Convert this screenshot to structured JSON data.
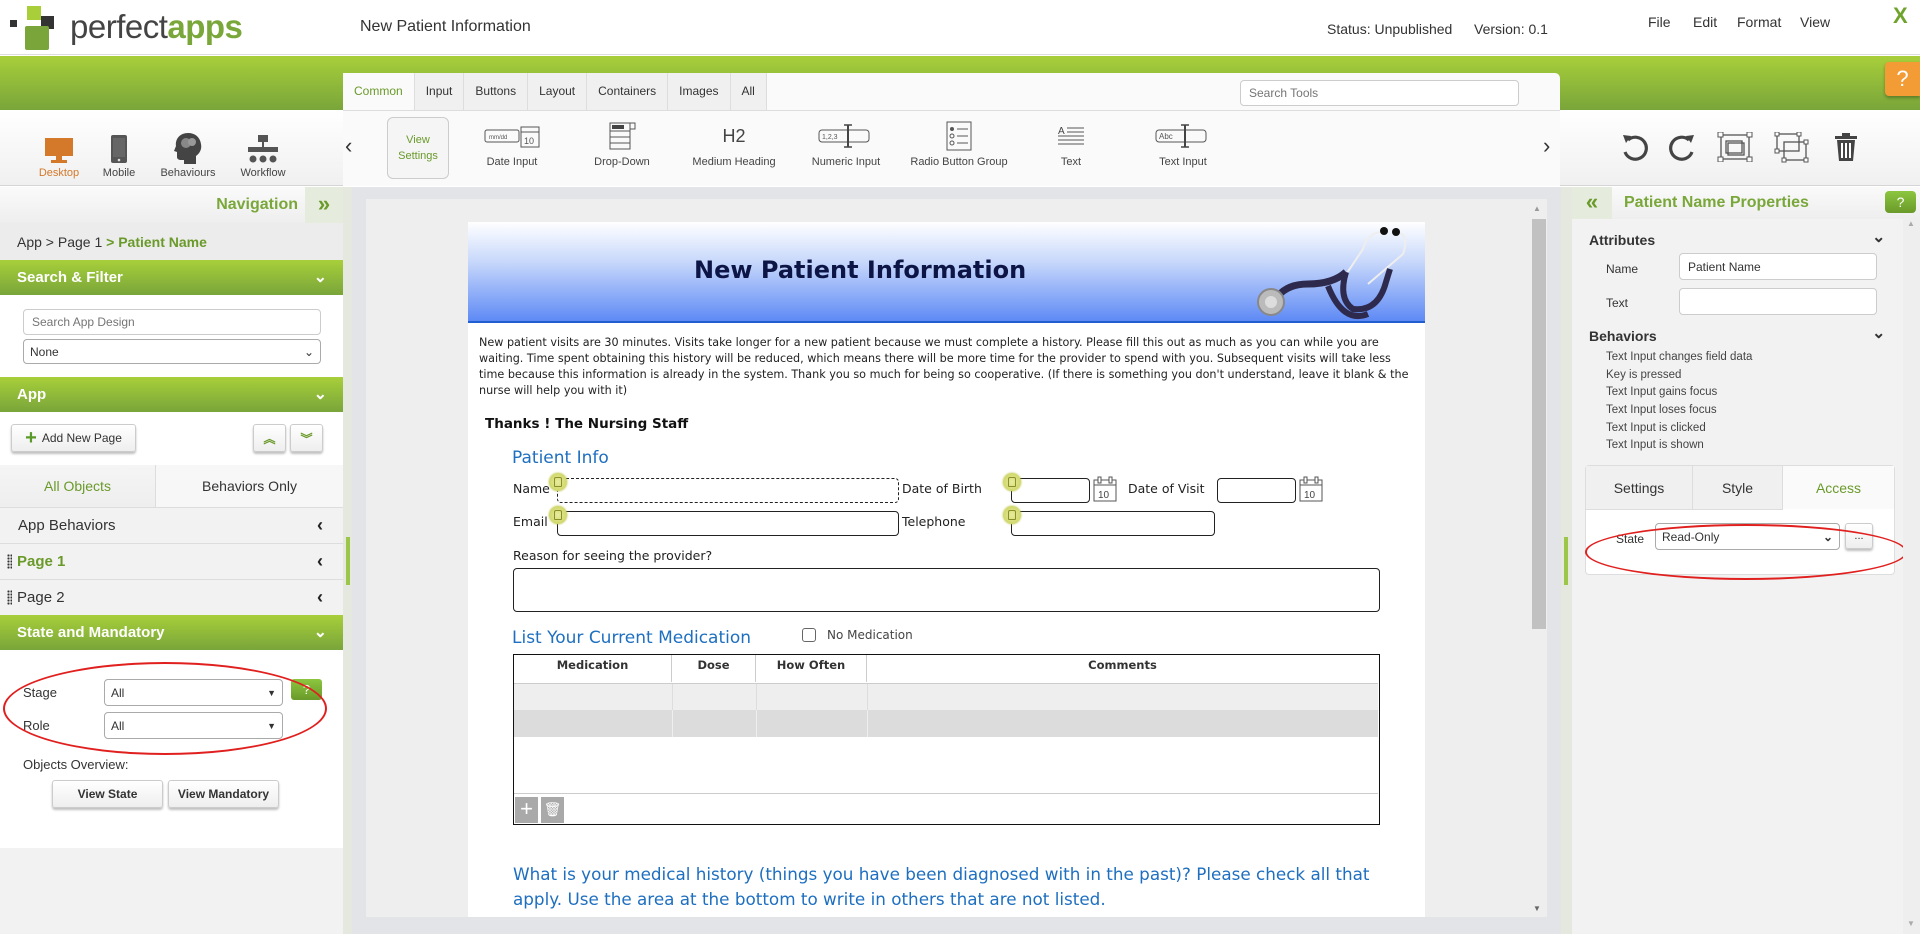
{
  "header": {
    "logo_text_plain": "perfect",
    "logo_text_bold": "apps",
    "app_title": "New Patient Information",
    "status": "Status: Unpublished",
    "version": "Version: 0.1",
    "menus": [
      "File",
      "Edit",
      "Format",
      "View"
    ],
    "close_label": "X",
    "help_label": "?"
  },
  "colors": {
    "brand_green": "#7aa73a",
    "accent_orange": "#d4782a",
    "help_orange": "#f39b35",
    "annotation_red": "#e0201e",
    "form_blue": "#1e6fc0"
  },
  "modes": [
    {
      "label": "Desktop",
      "icon": "desktop-icon",
      "active": true
    },
    {
      "label": "Mobile",
      "icon": "mobile-icon",
      "active": false
    },
    {
      "label": "Behaviours",
      "icon": "brain-icon",
      "active": false
    },
    {
      "label": "Workflow",
      "icon": "workflow-icon",
      "active": false
    }
  ],
  "palette": {
    "tabs": [
      "Common",
      "Input",
      "Buttons",
      "Layout",
      "Containers",
      "Images",
      "All"
    ],
    "active_tab": "Common",
    "search_placeholder": "Search Tools",
    "view_settings_line1": "View",
    "view_settings_line2": "Settings",
    "tools": [
      {
        "label": "Date Input",
        "icon": "date-input-icon"
      },
      {
        "label": "Drop-Down",
        "icon": "dropdown-icon"
      },
      {
        "label": "Medium Heading",
        "icon": "heading-h2-icon",
        "glyph": "H2"
      },
      {
        "label": "Numeric Input",
        "icon": "numeric-input-icon"
      },
      {
        "label": "Radio Button Group",
        "icon": "radio-group-icon"
      },
      {
        "label": "Text",
        "icon": "text-icon"
      },
      {
        "label": "Text Input",
        "icon": "text-input-icon"
      }
    ]
  },
  "right_toolbar": [
    "undo-icon",
    "redo-icon",
    "group-icon",
    "ungroup-icon",
    "trash-icon"
  ],
  "left_panel": {
    "nav_title": "Navigation",
    "breadcrumb": {
      "prefix": "App > Page 1",
      "current": " > Patient Name"
    },
    "search_filter": {
      "title": "Search & Filter",
      "search_placeholder": "Search App Design",
      "filter_value": "None"
    },
    "app_section": {
      "title": "App",
      "add_page_label": "Add New Page"
    },
    "subtabs": [
      "All Objects",
      "Behaviors Only"
    ],
    "active_subtab": "All Objects",
    "tree": [
      {
        "label": "App Behaviors",
        "active": false,
        "grip": false
      },
      {
        "label": "Page 1",
        "active": true,
        "grip": true
      },
      {
        "label": "Page 2",
        "active": false,
        "grip": true
      }
    ],
    "state_mandatory": {
      "title": "State and Mandatory",
      "stage_label": "Stage",
      "stage_value": "All",
      "role_label": "Role",
      "role_value": "All",
      "help_label": "?",
      "overview_label": "Objects Overview:",
      "view_state_label": "View State",
      "view_mandatory_label": "View Mandatory"
    }
  },
  "form": {
    "banner_title": "New Patient Information",
    "intro": "New patient visits are 30 minutes. Visits take longer for a new patient because we must complete a history. Please fill this out as much as you can while you are waiting. Time spent obtaining this history will be reduced, which means there will be more time for the provider to spend with you. Subsequent visits will take less time because this information is already in the system. Thank you so much for being so cooperative. (If there is something you don't understand, leave it blank & the nurse will help you with it)",
    "thanks": "Thanks ! The Nursing Staff",
    "patient_info_title": "Patient Info",
    "fields": {
      "name": "Name",
      "dob": "Date of Birth",
      "dov": "Date of Visit",
      "email": "Email",
      "telephone": "Telephone",
      "reason": "Reason for seeing the provider?"
    },
    "calendar_day": "10",
    "medication_title": "List Your Current Medication",
    "no_medication_label": "No Medication",
    "no_medication_checked": false,
    "med_columns": [
      "Medication",
      "Dose",
      "How Often",
      "Comments"
    ],
    "med_rows": [
      [
        "",
        "",
        "",
        ""
      ],
      [
        "",
        "",
        "",
        ""
      ]
    ],
    "history_text": "What is your medical history (things you have been diagnosed with in the past)? Please check all that apply. Use the area at the bottom to write in others that are not listed."
  },
  "right_panel": {
    "title": "Patient Name Properties",
    "help_label": "?",
    "attributes_title": "Attributes",
    "name_label": "Name",
    "name_value": "Patient Name",
    "text_label": "Text",
    "text_value": "",
    "behaviors_title": "Behaviors",
    "behaviors": [
      "Text Input changes field data",
      "Key is pressed",
      "Text Input gains focus",
      "Text Input loses focus",
      "Text Input is clicked",
      "Text Input is shown"
    ],
    "tabs": [
      "Settings",
      "Style",
      "Access"
    ],
    "active_tab": "Access",
    "state_label": "State",
    "state_value": "Read-Only",
    "more_label": "..."
  }
}
